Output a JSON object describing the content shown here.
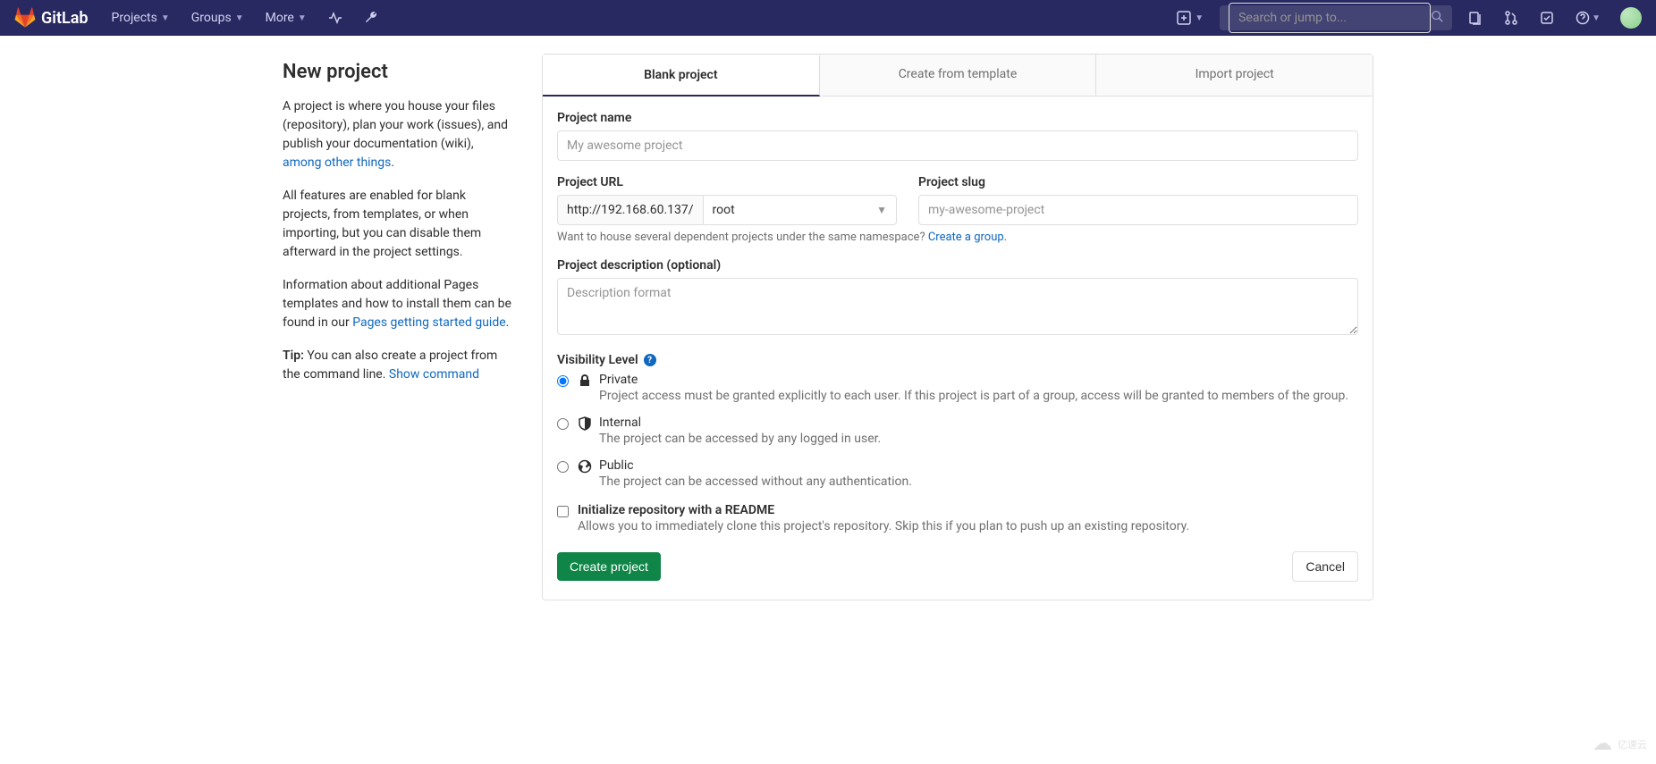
{
  "navbar": {
    "brand": "GitLab",
    "projects": "Projects",
    "groups": "Groups",
    "more": "More",
    "search_placeholder": "Search or jump to..."
  },
  "sidebar": {
    "title": "New project",
    "p1_a": "A project is where you house your files (repository), plan your work (issues), and publish your documentation (wiki), ",
    "p1_link": "among other things",
    "p1_b": ".",
    "p2": "All features are enabled for blank projects, from templates, or when importing, but you can disable them afterward in the project settings.",
    "p3_a": "Information about additional Pages templates and how to install them can be found in our ",
    "p3_link": "Pages getting started guide",
    "p3_b": ".",
    "tip_label": "Tip:",
    "tip_text": " You can also create a project from the command line. ",
    "tip_link": "Show command"
  },
  "tabs": {
    "blank": "Blank project",
    "template": "Create from template",
    "import": "Import project"
  },
  "form": {
    "name_label": "Project name",
    "name_placeholder": "My awesome project",
    "url_label": "Project URL",
    "url_prefix": "http://192.168.60.137/",
    "namespace": "root",
    "slug_label": "Project slug",
    "slug_placeholder": "my-awesome-project",
    "namespace_hint": "Want to house several dependent projects under the same namespace? ",
    "namespace_link": "Create a group.",
    "desc_label": "Project description (optional)",
    "desc_placeholder": "Description format",
    "visibility_label": "Visibility Level",
    "vis_private_title": "Private",
    "vis_private_desc": "Project access must be granted explicitly to each user. If this project is part of a group, access will be granted to members of the group.",
    "vis_internal_title": "Internal",
    "vis_internal_desc": "The project can be accessed by any logged in user.",
    "vis_public_title": "Public",
    "vis_public_desc": "The project can be accessed without any authentication.",
    "readme_title": "Initialize repository with a README",
    "readme_desc": "Allows you to immediately clone this project's repository. Skip this if you plan to push up an existing repository.",
    "create_btn": "Create project",
    "cancel_btn": "Cancel"
  },
  "watermark": "亿速云"
}
